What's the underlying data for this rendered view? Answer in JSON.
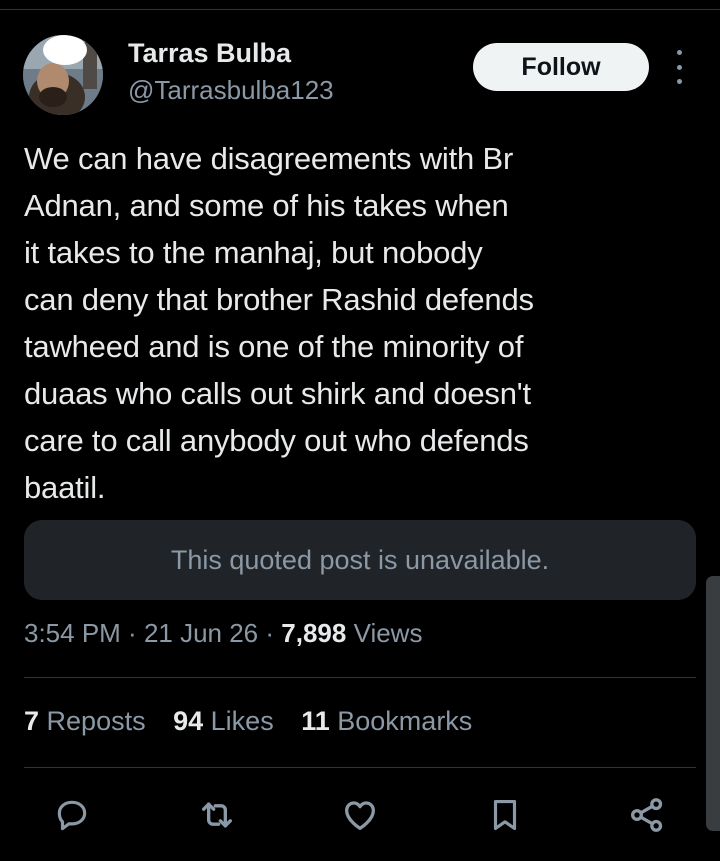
{
  "author": {
    "display_name": "Tarras Bulba",
    "handle": "@Tarrasbulba123"
  },
  "follow_button_label": "Follow",
  "tweet_text": "We can have disagreements with Br\nAdnan, and some of his takes when\nit takes to the manhaj, but nobody\ncan deny that brother Rashid defends\ntawheed and is one of the minority of\nduaas who calls out shirk and doesn't\ncare to call anybody out who defends\nbaatil.",
  "quoted_post_notice": "This quoted post is unavailable.",
  "meta": {
    "time": "3:54 PM",
    "sep1": " · ",
    "date": "21 Jun 26",
    "sep2": " · ",
    "views_count": "7,898",
    "views_label": " Views"
  },
  "stats": {
    "reposts_count": "7",
    "reposts_label": " Reposts",
    "likes_count": "94",
    "likes_label": " Likes",
    "bookmarks_count": "11",
    "bookmarks_label": " Bookmarks"
  },
  "icons": [
    "reply-icon",
    "repost-icon",
    "like-icon",
    "bookmark-icon",
    "share-icon",
    "more-options-icon"
  ],
  "colors": {
    "background": "#000000",
    "primary_text": "#e7e9ea",
    "secondary_text": "#8b98a5",
    "follow_button_bg": "#eff3f4",
    "quoted_box_bg": "#202327"
  }
}
